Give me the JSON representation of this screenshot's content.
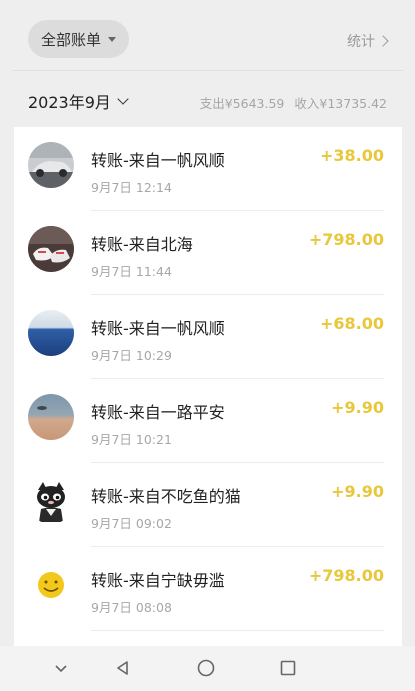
{
  "header": {
    "filter_label": "全部账单",
    "stats_label": "统计"
  },
  "month": {
    "label": "2023年9月",
    "expense": "支出¥5643.59",
    "income": "收入¥13735.42"
  },
  "transactions": [
    {
      "title": "转账-来自一帆风顺",
      "time": "9月7日 12:14",
      "amount": "+38.00",
      "avatar": "car-photo"
    },
    {
      "title": "转账-来自北海",
      "time": "9月7日 11:44",
      "amount": "+798.00",
      "avatar": "sneakers-photo"
    },
    {
      "title": "转账-来自一帆风顺",
      "time": "9月7日 10:29",
      "amount": "+68.00",
      "avatar": "sea-photo"
    },
    {
      "title": "转账-来自一路平安",
      "time": "9月7日 10:21",
      "amount": "+9.90",
      "avatar": "beach-photo"
    },
    {
      "title": "转账-来自不吃鱼的猫",
      "time": "9月7日 09:02",
      "amount": "+9.90",
      "avatar": "cartoon-cat"
    },
    {
      "title": "转账-来自宁缺毋滥",
      "time": "9月7日 08:08",
      "amount": "+798.00",
      "avatar": "smiley-face"
    }
  ],
  "colors": {
    "amount": "#e8c73a",
    "background": "#eeeeee",
    "card": "#ffffff"
  },
  "nav": {
    "items": [
      "collapse-icon",
      "back-icon",
      "home-icon",
      "recents-icon"
    ]
  }
}
